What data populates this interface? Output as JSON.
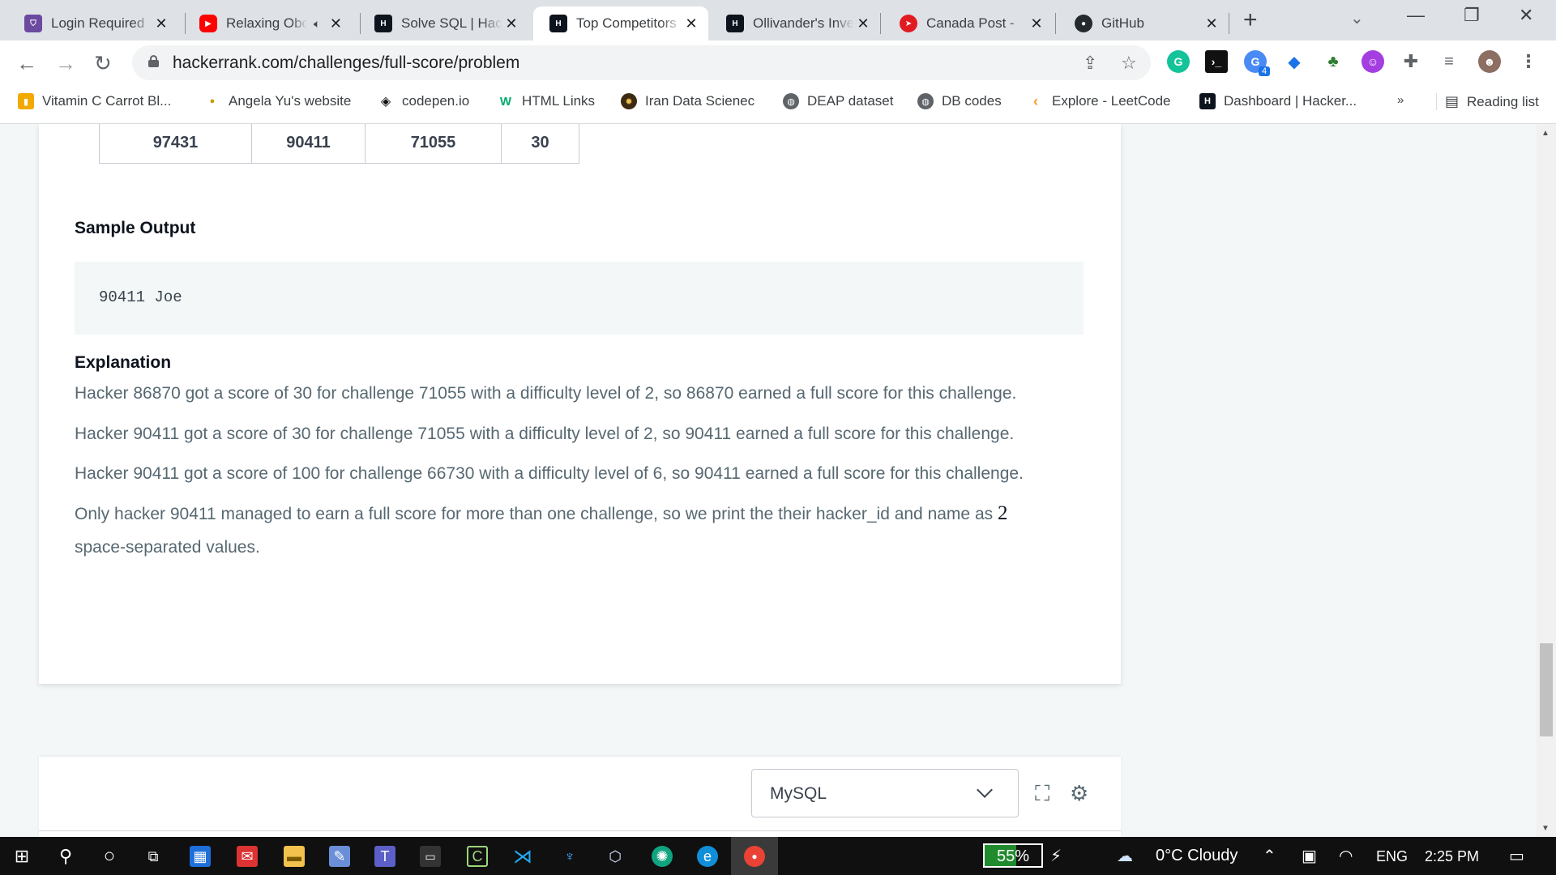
{
  "browser": {
    "tabs": [
      {
        "title": "Login Required",
        "favicon": "shield-icon",
        "color": "#6b4aa0",
        "active": false
      },
      {
        "title": "Relaxing Oboe Music",
        "favicon": "youtube-icon",
        "color": "#ff0000",
        "active": false,
        "audio": true
      },
      {
        "title": "Solve SQL | HackerRank",
        "favicon": "hackerrank-icon",
        "color": "#0e141e",
        "active": false
      },
      {
        "title": "Top Competitors",
        "favicon": "hackerrank-icon",
        "color": "#0e141e",
        "active": true
      },
      {
        "title": "Ollivander's Inventory",
        "favicon": "hackerrank-icon",
        "color": "#0e141e",
        "active": false
      },
      {
        "title": "Canada Post - ",
        "favicon": "canada-post-icon",
        "color": "#e11b22",
        "active": false
      },
      {
        "title": "GitHub",
        "favicon": "github-icon",
        "color": "#24292e",
        "active": false
      }
    ],
    "url": "hackerrank.com/challenges/full-score/problem",
    "extension_badge": "4",
    "bookmarks": [
      {
        "label": "Vitamin C Carrot Bl...",
        "icon": "bag-icon"
      },
      {
        "label": "Angela Yu's website",
        "icon": "pin-icon"
      },
      {
        "label": "codepen.io",
        "icon": "codepen-icon"
      },
      {
        "label": "HTML Links",
        "icon": "w3-icon"
      },
      {
        "label": "Iran Data Scienec",
        "icon": "circle-logo-icon"
      },
      {
        "label": "DEAP dataset",
        "icon": "globe-icon"
      },
      {
        "label": "DB codes",
        "icon": "globe-icon"
      },
      {
        "label": "Explore - LeetCode",
        "icon": "leetcode-icon"
      },
      {
        "label": "Dashboard | Hacker...",
        "icon": "hackerrank-icon"
      }
    ],
    "more_bookmarks": "»",
    "reading_list": "Reading list"
  },
  "problem": {
    "sample_table_row": [
      "97431",
      "90411",
      "71055",
      "30"
    ],
    "sample_output_heading": "Sample Output",
    "sample_output": "90411 Joe",
    "explanation_heading": "Explanation",
    "explanation": [
      "Hacker 86870 got a score of 30 for challenge 71055 with a difficulty level of 2, so 86870 earned a full score for this challenge.",
      "Hacker 90411 got a score of 30 for challenge 71055 with a difficulty level of 2, so 90411 earned a full score for this challenge.",
      "Hacker 90411 got a score of 100 for challenge 66730 with a difficulty level of 6, so 90411 earned a full score for this challenge."
    ],
    "explanation_last_a": "Only hacker 90411 managed to earn a full score for more than one challenge, so we print the their hacker_id and name as ",
    "explanation_last_num": "2",
    "explanation_last_b": "space-separated values."
  },
  "editor": {
    "language": "MySQL"
  },
  "taskbar": {
    "battery": "55%",
    "battery_level": 0.55,
    "weather": "0°C  Cloudy",
    "language": "ENG",
    "time": "2:25 PM"
  }
}
